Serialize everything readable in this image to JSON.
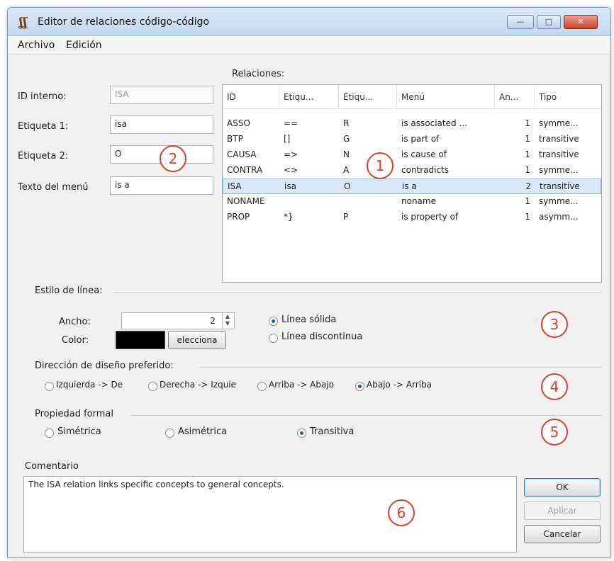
{
  "window": {
    "title": "Editor de relaciones código-código",
    "controls": {
      "minimize": "—",
      "maximize": "□",
      "close": "✕"
    }
  },
  "menu": [
    "Archivo",
    "Edición"
  ],
  "form": {
    "internal_id": {
      "label": "ID interno:",
      "value": "ISA"
    },
    "label1": {
      "label": "Etiqueta 1:",
      "value": "isa"
    },
    "label2": {
      "label": "Etiqueta 2:",
      "value": "O"
    },
    "menu_text": {
      "label": "Texto del menú",
      "value": "is a"
    }
  },
  "relations": {
    "title": "Relaciones:",
    "columns": [
      "ID",
      "Etiqu...",
      "Etiqu...",
      "Menú",
      "An...",
      "Tipo"
    ],
    "rows": [
      {
        "id": "ASSO",
        "e1": "==",
        "e2": "R",
        "menu": "is associated ...",
        "n": "1",
        "type": "symme..."
      },
      {
        "id": "BTP",
        "e1": "[]",
        "e2": "G",
        "menu": "is part of",
        "n": "1",
        "type": "transitive"
      },
      {
        "id": "CAUSA",
        "e1": "=>",
        "e2": "N",
        "menu": "is cause of",
        "n": "1",
        "type": "transitive"
      },
      {
        "id": "CONTRA",
        "e1": "<>",
        "e2": "A",
        "menu": "contradicts",
        "n": "1",
        "type": "symme..."
      },
      {
        "id": "ISA",
        "e1": "isa",
        "e2": "O",
        "menu": "is a",
        "n": "2",
        "type": "transitive",
        "selected": true
      },
      {
        "id": "NONAME",
        "e1": "",
        "e2": "",
        "menu": "noname",
        "n": "1",
        "type": "symme..."
      },
      {
        "id": "PROP",
        "e1": "*}",
        "e2": "P",
        "menu": "is property of",
        "n": "1",
        "type": "asymm..."
      }
    ]
  },
  "line_style": {
    "title": "Estilo de línea:",
    "width_label": "Ancho:",
    "width_value": "2",
    "color_label": "Color:",
    "color_value": "#000000",
    "select_button": "elecciona",
    "solid": "Línea sólida",
    "dashed": "Línea discontinua",
    "selected": "solid"
  },
  "direction": {
    "title": "Dirección de diseño preferido:",
    "options": [
      "Izquierda -> De",
      "Derecha -> Izquie",
      "Arriba -> Abajo",
      "Abajo -> Arriba"
    ],
    "selected_index": 3
  },
  "formal": {
    "title": "Propiedad formal",
    "options": [
      "Simétrica",
      "Asimétrica",
      "Transitiva"
    ],
    "selected_index": 2
  },
  "comment": {
    "title": "Comentario",
    "text": "The ISA relation links specific concepts to general concepts."
  },
  "buttons": {
    "ok": "OK",
    "apply": "Aplicar",
    "cancel": "Cancelar"
  },
  "markers": [
    "1",
    "2",
    "3",
    "4",
    "5",
    "6"
  ],
  "colors": {
    "marker": "#d9412a",
    "selected_row": "#d9e9fa",
    "titlebar": "#c3d7ee"
  }
}
